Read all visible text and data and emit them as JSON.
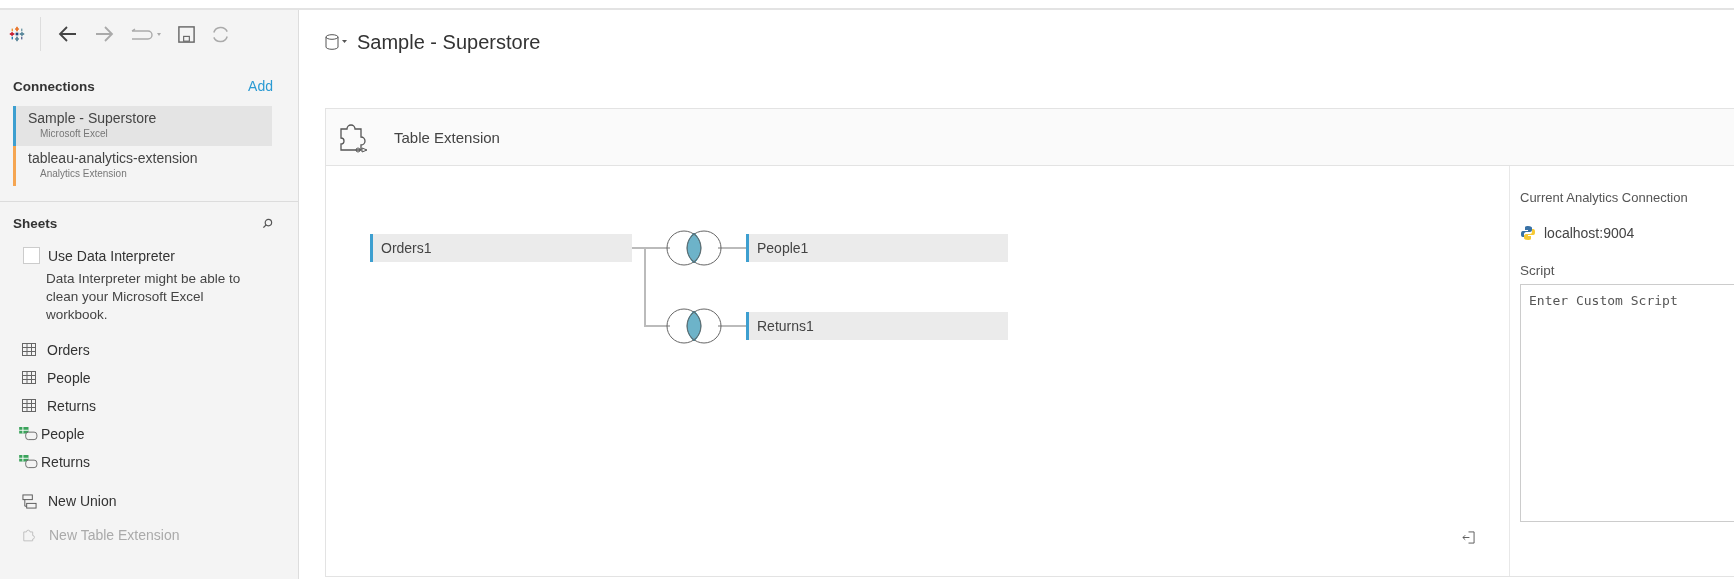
{
  "connections_panel": {
    "heading": "Connections",
    "add_link": "Add",
    "items": [
      {
        "name": "Sample - Superstore",
        "type": "Microsoft Excel",
        "color": "#3d9fd0",
        "selected": true
      },
      {
        "name": "tableau-analytics-extension",
        "type": "Analytics Extension",
        "color": "#f5a551",
        "selected": false
      }
    ]
  },
  "sheets_panel": {
    "heading": "Sheets",
    "data_interpreter": {
      "label": "Use Data Interpreter",
      "checked": false,
      "description": "Data Interpreter might be able to clean your Microsoft Excel workbook."
    },
    "items": [
      {
        "kind": "table",
        "label": "Orders"
      },
      {
        "kind": "table",
        "label": "People"
      },
      {
        "kind": "table",
        "label": "Returns"
      },
      {
        "kind": "named-range",
        "label": "People"
      },
      {
        "kind": "named-range",
        "label": "Returns"
      }
    ],
    "actions": [
      {
        "kind": "union",
        "label": "New Union",
        "disabled": false
      },
      {
        "kind": "extension",
        "label": "New Table Extension",
        "disabled": true
      }
    ]
  },
  "datasource": {
    "title": "Sample - Superstore"
  },
  "extension_panel": {
    "title": "Table Extension",
    "left_table": "Orders1",
    "joins": [
      {
        "table": "People1"
      },
      {
        "table": "Returns1"
      }
    ],
    "sidebar": {
      "heading": "Current Analytics Connection",
      "connection": "localhost:9004",
      "script_label": "Script",
      "script_placeholder": "Enter Custom Script"
    }
  }
}
